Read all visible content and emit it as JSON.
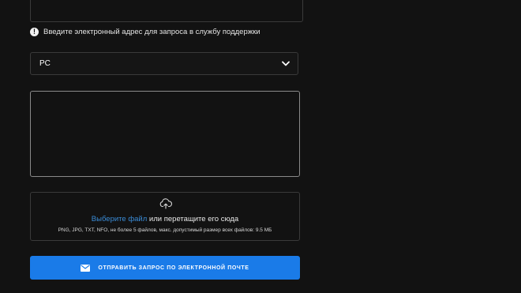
{
  "form": {
    "email": {
      "value": "",
      "hint": "Введите электронный адрес для запроса в службу поддержки"
    },
    "platform": {
      "selected": "PC"
    },
    "message": {
      "value": ""
    },
    "attachments": {
      "link_text": "Выберите файл",
      "drop_text": " или перетащите его сюда",
      "requirements": "PNG, JPG, TXT, NFO, не более 5 файлов, макс. допустимый размер всех файлов: 9.5 МБ"
    },
    "submit": {
      "label": "ОТПРАВИТЬ ЗАПРОС ПО ЭЛЕКТРОННОЙ ПОЧТЕ"
    }
  },
  "colors": {
    "background": "#121212",
    "accent": "#1a7be8",
    "link": "#3a8bd6",
    "border": "#3a3a3a"
  },
  "icons": {
    "hint": "info-icon",
    "select": "chevron-down-icon",
    "upload": "cloud-upload-icon",
    "submit": "mail-icon"
  }
}
